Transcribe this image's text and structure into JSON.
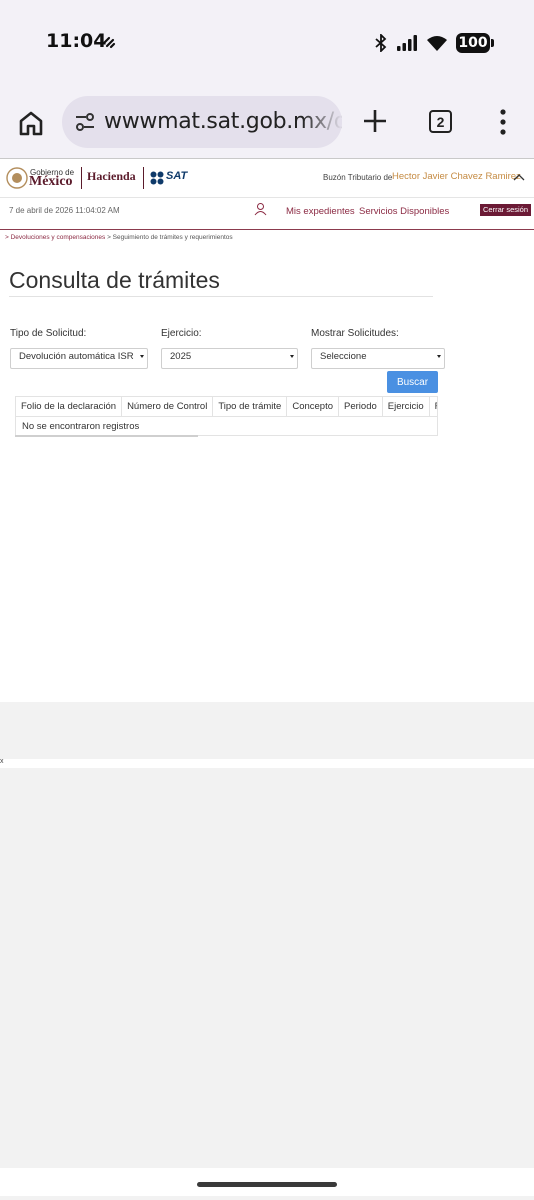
{
  "status_bar": {
    "time": "11:04",
    "battery": "100",
    "icons": [
      "notification-icon",
      "bluetooth-icon",
      "signal-icon",
      "wifi-icon",
      "battery-icon"
    ]
  },
  "browser": {
    "url": "wwwmat.sat.gob.mx/ope",
    "tab_count": "2",
    "icons": [
      "home-icon",
      "site-settings-icon",
      "new-tab-icon",
      "tabs-icon",
      "menu-icon"
    ]
  },
  "header": {
    "gob_small": "Gobierno de",
    "gob_big": "México",
    "hacienda": "Hacienda",
    "sat": "SAT",
    "buzon_label": "Buzón Tributario de",
    "user_name": "Hector Javier Chavez Ramirez"
  },
  "nav": {
    "date": "7 de abril de 2026 11:04:02 AM",
    "links": [
      "Mis expedientes",
      "Servicios Disponibles"
    ],
    "logout": "Cerrar sesión"
  },
  "breadcrumb": {
    "link": "> Devoluciones y compensaciones",
    "current": "> Seguimiento de trámites y requerimientos"
  },
  "page": {
    "title": "Consulta de trámites"
  },
  "form": {
    "tipo_label": "Tipo de Solicitud:",
    "tipo_value": "Devolución automática ISR",
    "ejercicio_label": "Ejercicio:",
    "ejercicio_value": "2025",
    "mostrar_label": "Mostrar Solicitudes:",
    "mostrar_value": "Seleccione",
    "search_button": "Buscar"
  },
  "table": {
    "columns": [
      "Folio de la declaración",
      "Número de Control",
      "Tipo de trámite",
      "Concepto",
      "Periodo",
      "Ejercicio",
      "Fecha"
    ],
    "empty_message": "No se encontraron registros"
  },
  "misc": {
    "x_mark": "x"
  },
  "colors": {
    "brand": "#5b1b2b",
    "accent_link": "#8b2a43",
    "user_name": "#c58b43",
    "button": "#4a90e2"
  }
}
